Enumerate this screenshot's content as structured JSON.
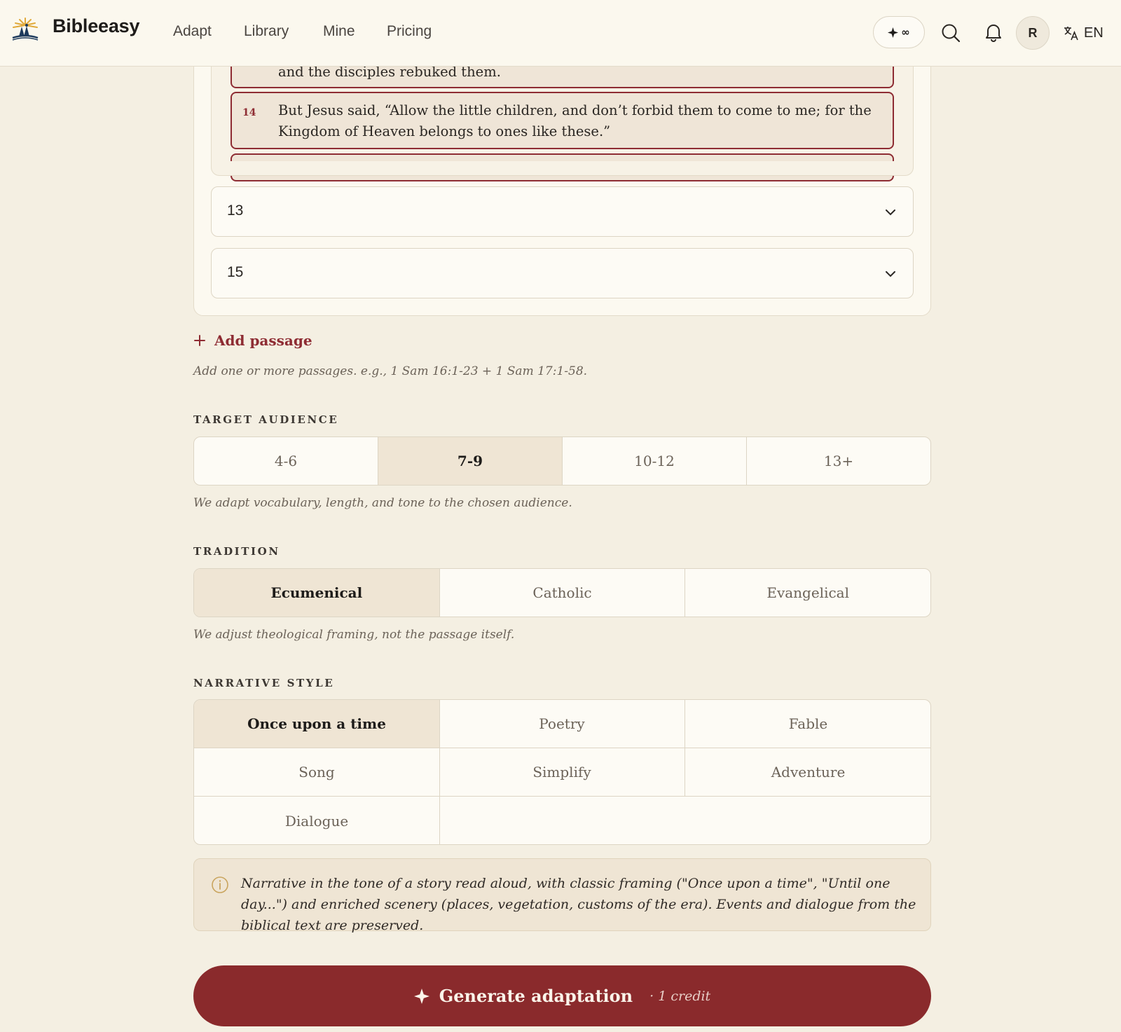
{
  "header": {
    "brand": "Bibleeasy",
    "nav": [
      {
        "label": "Adapt"
      },
      {
        "label": "Library"
      },
      {
        "label": "Mine"
      },
      {
        "label": "Pricing"
      }
    ],
    "credits_symbol": "∞",
    "avatar_initial": "R",
    "language": "EN"
  },
  "passage": {
    "verses": [
      {
        "number": "",
        "text": "and the disciples rebuked them."
      },
      {
        "number": "14",
        "text": "But Jesus said, “Allow the little children, and don’t forbid them to come to me; for the Kingdom of Heaven belongs to ones like these.”"
      }
    ],
    "from_verse": "13",
    "to_verse": "15"
  },
  "add_passage": {
    "label": "Add passage",
    "hint": "Add one or more passages. e.g., 1 Sam 16:1-23 + 1 Sam 17:1-58."
  },
  "audience": {
    "title": "TARGET AUDIENCE",
    "options": [
      "4-6",
      "7-9",
      "10-12",
      "13+"
    ],
    "selected": "7-9",
    "hint": "We adapt vocabulary, length, and tone to the chosen audience."
  },
  "tradition": {
    "title": "TRADITION",
    "options": [
      "Ecumenical",
      "Catholic",
      "Evangelical"
    ],
    "selected": "Ecumenical",
    "hint": "We adjust theological framing, not the passage itself."
  },
  "narrative": {
    "title": "NARRATIVE STYLE",
    "options": [
      "Once upon a time",
      "Poetry",
      "Fable",
      "Song",
      "Simplify",
      "Adventure",
      "Dialogue"
    ],
    "selected": "Once upon a time",
    "description": "Narrative in the tone of a story read aloud, with classic framing (\"Once upon a time\", \"Until one day...\") and enriched scenery (places, vegetation, customs of the era). Events and dialogue from the biblical text are preserved."
  },
  "generate": {
    "label": "Generate adaptation",
    "credit": "· 1 credit"
  },
  "colors": {
    "accent": "#8a2a2c",
    "background": "#f4efe2",
    "selected": "#efe5d4"
  }
}
